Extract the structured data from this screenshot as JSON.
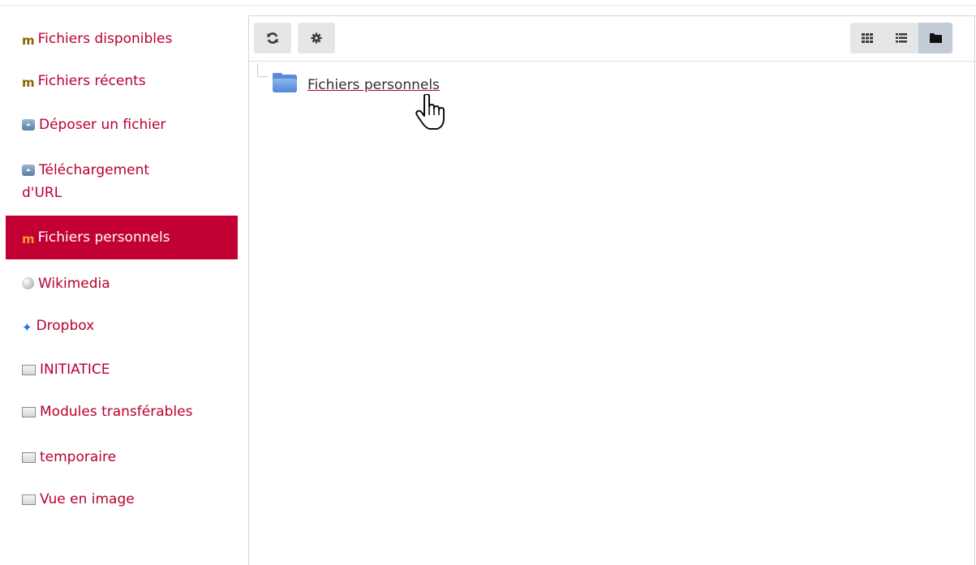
{
  "sidebar": {
    "items": [
      {
        "label": "Fichiers disponibles",
        "icon": "moodle-icon"
      },
      {
        "label": "Fichiers récents",
        "icon": "moodle-icon"
      },
      {
        "label": "Déposer un fichier",
        "icon": "upload-icon"
      },
      {
        "label": "Téléchargement d'URL",
        "icon": "upload-icon"
      },
      {
        "label": "Fichiers personnels",
        "icon": "moodle-icon",
        "active": true
      },
      {
        "label": "Wikimedia",
        "icon": "wikimedia-icon"
      },
      {
        "label": "Dropbox",
        "icon": "dropbox-icon"
      },
      {
        "label": "INITIATICE",
        "icon": "repository-icon"
      },
      {
        "label": "Modules transférables",
        "icon": "repository-icon"
      },
      {
        "label": "temporaire",
        "icon": "repository-icon"
      },
      {
        "label": "Vue en image",
        "icon": "repository-icon"
      }
    ]
  },
  "toolbar": {
    "refresh_icon": "refresh-icon",
    "settings_icon": "gear-icon",
    "view_modes": [
      "grid-view-icon",
      "list-view-icon",
      "tree-view-icon"
    ],
    "selected_view": "tree-view-icon"
  },
  "tree": {
    "folder_label": "Fichiers personnels"
  },
  "colors": {
    "accent": "#c20033",
    "link": "#b8002f",
    "selected_view_bg": "#c3ccd6"
  }
}
